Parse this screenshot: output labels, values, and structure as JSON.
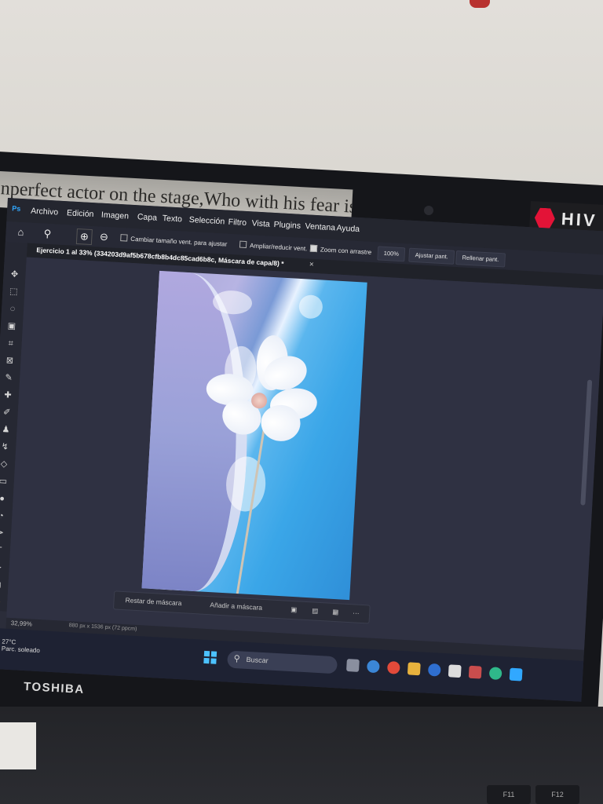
{
  "sticker_text": "nperfect actor on the stage,Who with his fear is",
  "hive_label": "HIV",
  "laptop_brand": "TOSHIBA",
  "app": {
    "logo": "Ps",
    "menu": [
      "Archivo",
      "Edición",
      "Imagen",
      "Capa",
      "Texto",
      "Selección",
      "Filtro",
      "Vista",
      "Plugins",
      "Ventana",
      "Ayuda"
    ]
  },
  "options": {
    "resize_windows": "Cambiar tamaño vent. para ajustar",
    "zoom_all": "Ampliar/reducir vent.",
    "scrubby_zoom": "Zoom con arrastre",
    "zoom_value": "100%",
    "fit_screen": "Ajustar pant.",
    "fill_screen": "Rellenar pant."
  },
  "document_tab": {
    "title": "Ejercicio 1 al 33% (334203d9af5b678cfb8b4dc85cad6b8c, Máscara de capa/8) *",
    "close": "×"
  },
  "mask_bar": {
    "subtract": "Restar de máscara",
    "add": "Añadir a máscara",
    "more": "···"
  },
  "status": {
    "zoom": "32,99%",
    "doc_info": "880 px x 1536 px (72 ppcm)"
  },
  "taskbar": {
    "temperature": "27°C",
    "weather": "Parc. soleado",
    "search_placeholder": "Buscar"
  },
  "keys": [
    "F11",
    "F12"
  ],
  "icons": {
    "home": "home-icon",
    "zoom": "magnifier-icon",
    "zoom_in": "zoom-in-icon",
    "zoom_out": "zoom-out-icon"
  },
  "colors": {
    "ps_blue": "#31a8ff",
    "hive_red": "#e31337",
    "screen_bg": "#2b2d3a"
  }
}
